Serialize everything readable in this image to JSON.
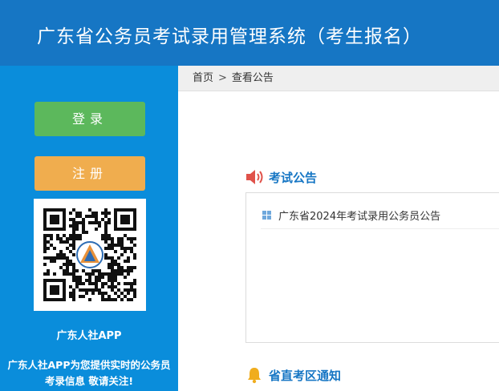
{
  "header": {
    "title": "广东省公务员考试录用管理系统（考生报名）"
  },
  "sidebar": {
    "login_label": "登录",
    "register_label": "注册",
    "app_name": "广东人社APP",
    "app_desc": "广东人社APP为您提供实时的公务员考录信息 敬请关注!"
  },
  "breadcrumb": {
    "home": "首页",
    "separator": ">",
    "current": "查看公告"
  },
  "exam_notices": {
    "title": "考试公告",
    "items": [
      {
        "label": "广东省2024年考试录用公务员公告"
      }
    ]
  },
  "district_notices": {
    "title": "省直考区通知"
  },
  "colors": {
    "header_bg": "#1676c4",
    "sidebar_bg": "#0a8ddb",
    "login_btn": "#5cb85c",
    "register_btn": "#f0ad4e",
    "section_title": "#1676c4",
    "speaker_icon": "#e0524a",
    "bell_icon": "#f0ad1e"
  },
  "icons": {
    "exam_notices": "speaker-icon",
    "district_notices": "bell-icon",
    "list_item": "grid-square-icon",
    "qr": "qr-code-icon"
  }
}
